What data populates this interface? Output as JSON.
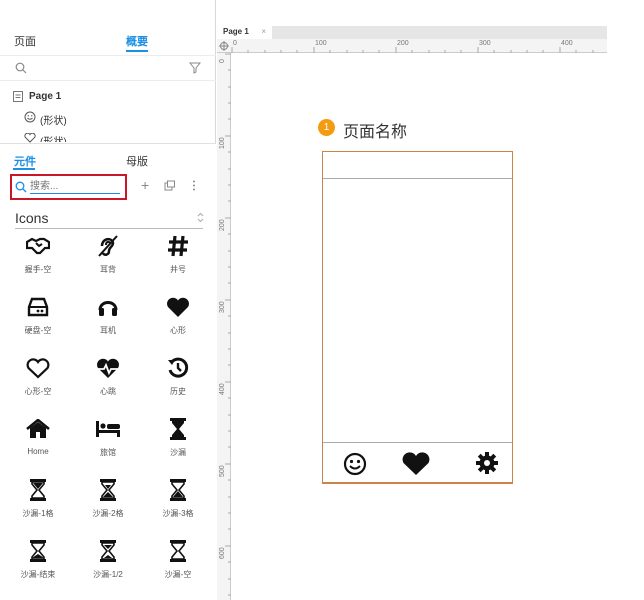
{
  "left_panel": {
    "tabs_top": [
      {
        "label": "页面"
      },
      {
        "label": "概要"
      }
    ],
    "tree": [
      {
        "label": "Page 1"
      },
      {
        "label": "(形状)"
      },
      {
        "label": "(形状)"
      }
    ],
    "tabs_bottom": [
      {
        "label": "元件"
      },
      {
        "label": "母版"
      }
    ],
    "search_placeholder": "搜索...",
    "library_name": "Icons",
    "icons": [
      {
        "label": "握手-空",
        "icon": "handshake-icon"
      },
      {
        "label": "耳背",
        "icon": "deaf-icon"
      },
      {
        "label": "井号",
        "icon": "hashtag-icon"
      },
      {
        "label": "硬盘-空",
        "icon": "hdd-icon"
      },
      {
        "label": "耳机",
        "icon": "headphones-icon"
      },
      {
        "label": "心形",
        "icon": "heart-icon"
      },
      {
        "label": "心形-空",
        "icon": "heart-outline-icon"
      },
      {
        "label": "心跳",
        "icon": "heartbeat-icon"
      },
      {
        "label": "历史",
        "icon": "history-icon"
      },
      {
        "label": "Home",
        "icon": "home-icon"
      },
      {
        "label": "旅馆",
        "icon": "hotel-icon"
      },
      {
        "label": "沙漏",
        "icon": "hourglass-icon"
      },
      {
        "label": "沙漏-1格",
        "icon": "hourglass-start-icon"
      },
      {
        "label": "沙漏-2格",
        "icon": "hourglass-half-icon"
      },
      {
        "label": "沙漏-3格",
        "icon": "hourglass-end-icon"
      },
      {
        "label": "沙漏-结束",
        "icon": "hourglass-done-icon"
      },
      {
        "label": "沙漏-1/2",
        "icon": "hourglass-half2-icon"
      },
      {
        "label": "沙漏-空",
        "icon": "hourglass-empty-icon"
      }
    ]
  },
  "editor": {
    "page_tab": "Page 1",
    "page_tab_close": "×",
    "hruler_labels": [
      "0",
      "100",
      "200",
      "300",
      "400"
    ],
    "vruler_labels": [
      "0",
      "100",
      "200",
      "300",
      "400",
      "500",
      "600"
    ]
  },
  "canvas": {
    "badge_number": "1",
    "page_name": "页面名称",
    "phone_tabbar": [
      {
        "icon": "smile-icon"
      },
      {
        "icon": "heart-icon"
      },
      {
        "icon": "gear-icon"
      }
    ],
    "accent_color": "#1a8fe3",
    "highlight_color": "#c91728",
    "badge_color": "#f39c12"
  }
}
